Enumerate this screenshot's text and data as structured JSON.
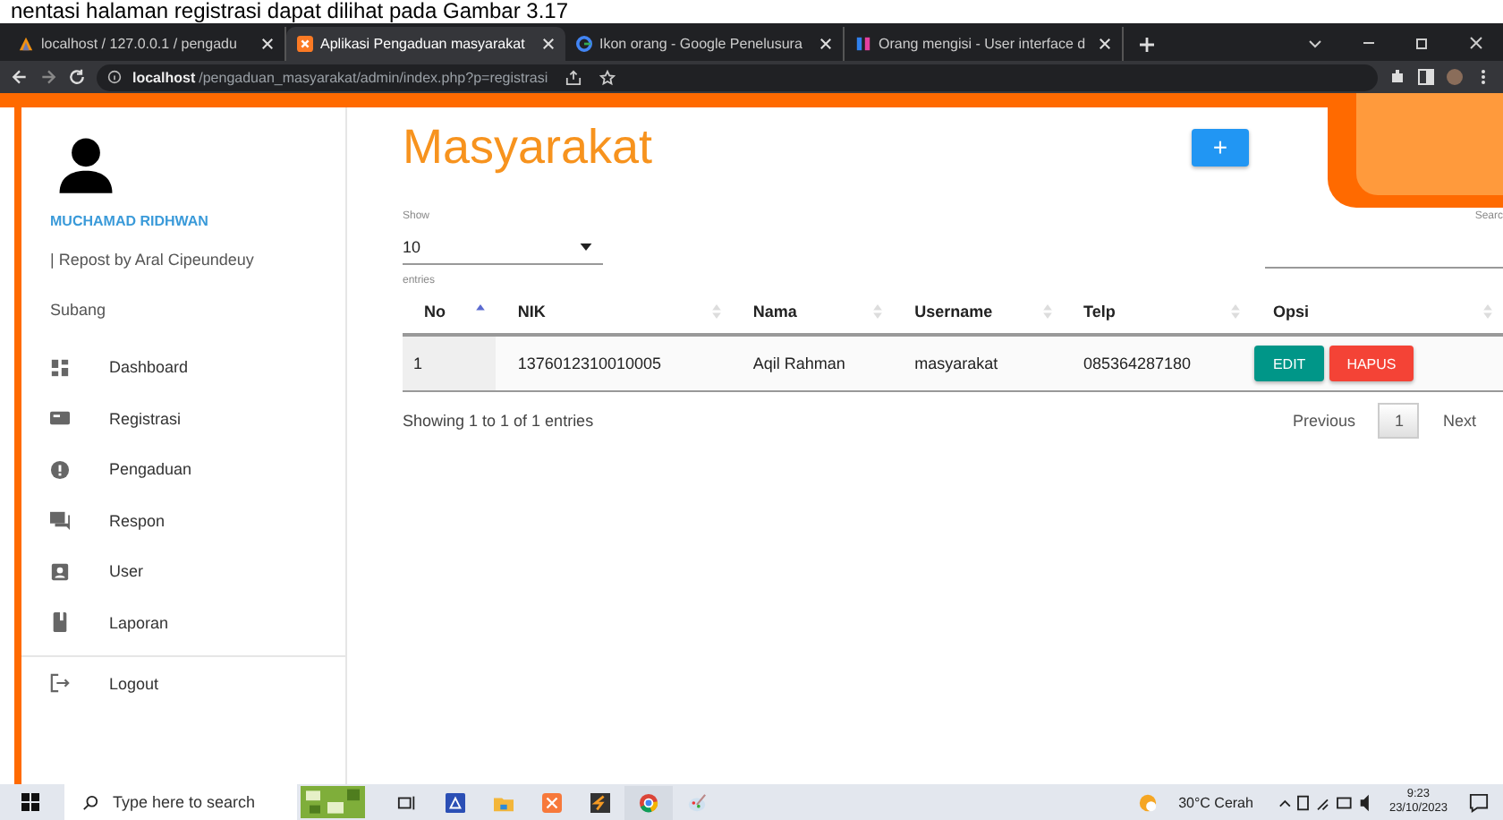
{
  "caption": "nentasi halaman registrasi dapat dilihat pada Gambar 3.17",
  "tabs": [
    {
      "label": "localhost / 127.0.0.1 / pengadu",
      "kind": "db",
      "selected": false
    },
    {
      "label": "Aplikasi Pengaduan masyarakat",
      "kind": "app",
      "selected": true
    },
    {
      "label": "Ikon orang - Google Penelusura",
      "kind": "google",
      "selected": false
    },
    {
      "label": "Orang mengisi - User interface d",
      "kind": "ui",
      "selected": false
    }
  ],
  "address": {
    "host": "localhost",
    "path": "/pengaduan_masyarakat/admin/index.php?p=registrasi"
  },
  "sidebar": {
    "name": "MUCHAMAD RIDHWAN",
    "subtitle": "| Repost by Aral Cipeundeuy",
    "location": "Subang",
    "items": [
      {
        "label": "Dashboard",
        "kind": "dashboard"
      },
      {
        "label": "Registrasi",
        "kind": "card"
      },
      {
        "label": "Pengaduan",
        "kind": "alert"
      },
      {
        "label": "Respon",
        "kind": "chat"
      },
      {
        "label": "User",
        "kind": "user"
      },
      {
        "label": "Laporan",
        "kind": "book"
      }
    ],
    "logout": "Logout"
  },
  "page": {
    "title": "Masyarakat",
    "add_button": "+",
    "show_label": "Show",
    "entries_value": "10",
    "entries_label": "entries",
    "search_label": "Searc",
    "columns": [
      {
        "label": "No",
        "sorted": true
      },
      {
        "label": "NIK",
        "sorted": false
      },
      {
        "label": "Nama",
        "sorted": false
      },
      {
        "label": "Username",
        "sorted": false
      },
      {
        "label": "Telp",
        "sorted": false
      },
      {
        "label": "Opsi",
        "sorted": false
      }
    ],
    "rows": [
      {
        "cells": [
          "1",
          "1376012310010005",
          "Aqil Rahman",
          "masyarakat",
          "085364287180"
        ],
        "edit": "EDIT",
        "delete": "HAPUS"
      }
    ],
    "info": "Showing 1 to 1 of 1 entries",
    "pages": [
      {
        "label": "Previous",
        "selected": false
      },
      {
        "label": "1",
        "selected": true
      },
      {
        "label": "Next",
        "selected": false
      }
    ]
  },
  "taskbar": {
    "search_placeholder": "Type here to search",
    "weather": "30°C Cerah",
    "time": "9:23",
    "date": "23/10/2023"
  }
}
